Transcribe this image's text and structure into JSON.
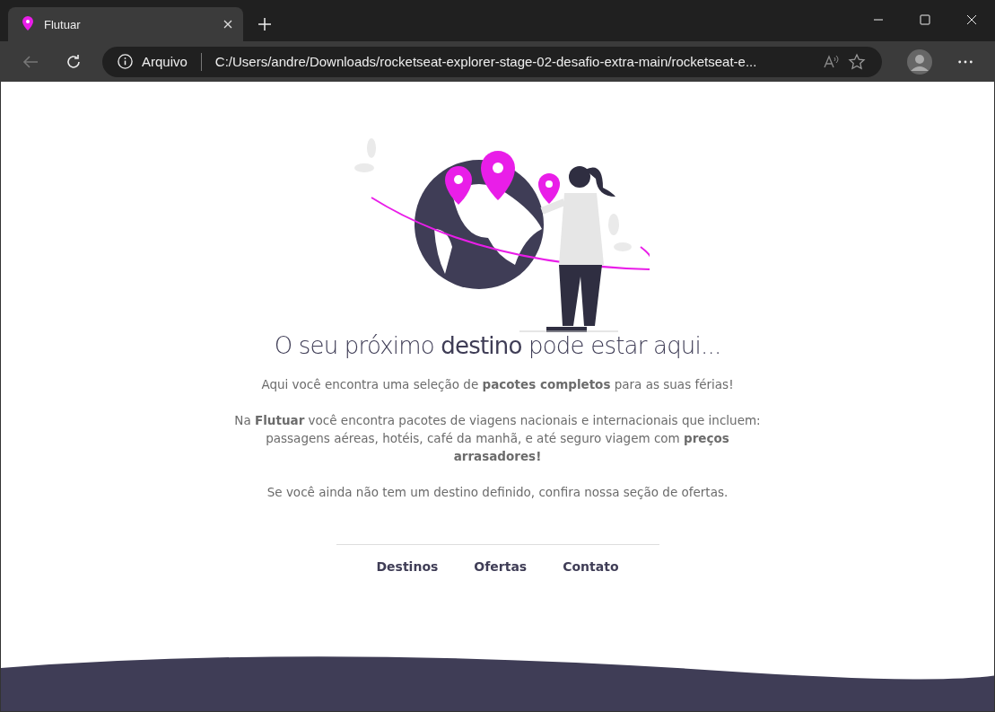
{
  "browser": {
    "tab_title": "Flutuar",
    "address_label": "Arquivo",
    "url": "C:/Users/andre/Downloads/rocketseat-explorer-stage-02-desafio-extra-main/rocketseat-e..."
  },
  "page": {
    "heading": "O seu próximo **destino** pode estar aqui...",
    "paragraphs": [
      "Aqui você encontra uma seleção de **pacotes completos** para as suas férias!",
      "Na **Flutuar** você encontra pacotes de viagens nacionais e internacionais que incluem: passagens aéreas, hotéis, café da manhã, e até seguro viagem com **preços arrasadores!**",
      "Se você ainda não tem um destino definido, confira nossa seção de ofertas."
    ],
    "nav": [
      "Destinos",
      "Ofertas",
      "Contato"
    ]
  }
}
